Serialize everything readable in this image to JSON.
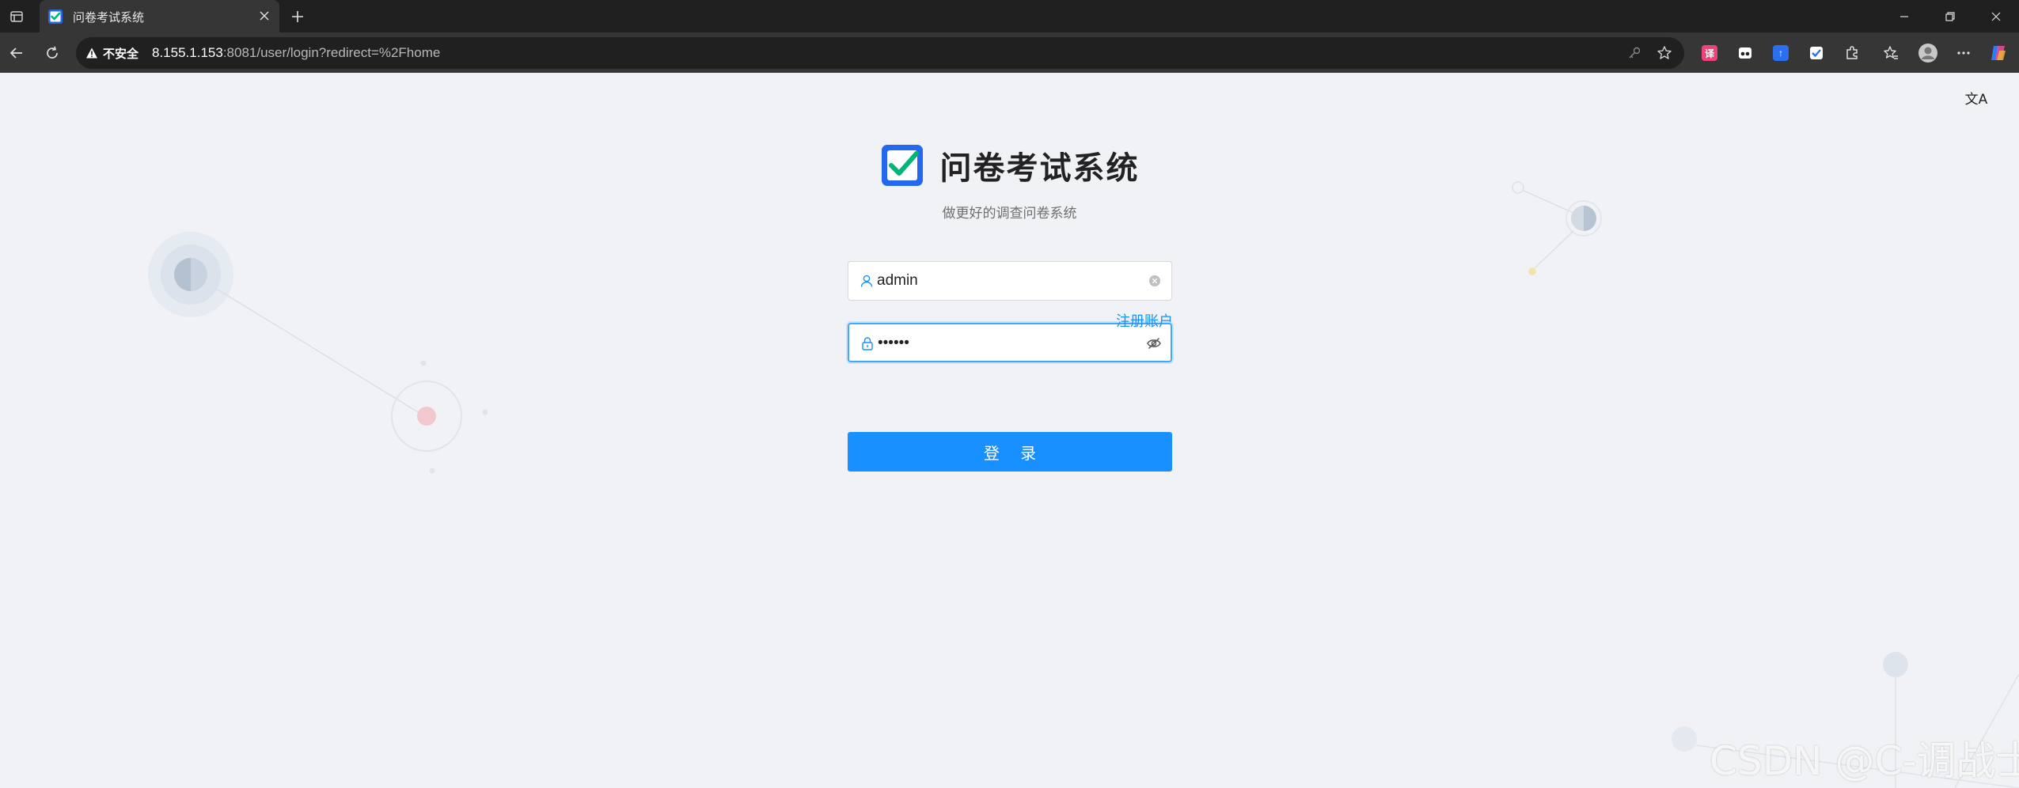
{
  "browser": {
    "tab": {
      "title": "问卷考试系统"
    },
    "address_bar": {
      "security_label": "不安全",
      "url_host": "8.155.1.153",
      "url_rest": ":8081/user/login?redirect=%2Fhome"
    }
  },
  "page": {
    "app_title": "问卷考试系统",
    "subtitle": "做更好的调查问卷系统",
    "username": {
      "value": "admin"
    },
    "password": {
      "value": "••••••"
    },
    "register_link": "注册账户",
    "login_button": "登 录",
    "lang_icon": "文A",
    "watermark": "CSDN @C-调战士"
  },
  "colors": {
    "primary": "#1890ff",
    "page_bg": "#f0f2f5",
    "browser_dark": "#202020",
    "browser_toolbar": "#363636",
    "logo_blue": "#2468f2",
    "logo_green": "#00b578"
  },
  "icons": {
    "username_prefix": "user-icon",
    "username_suffix": "clear-icon",
    "password_prefix": "lock-icon",
    "password_suffix": "eye-invisible-icon"
  }
}
